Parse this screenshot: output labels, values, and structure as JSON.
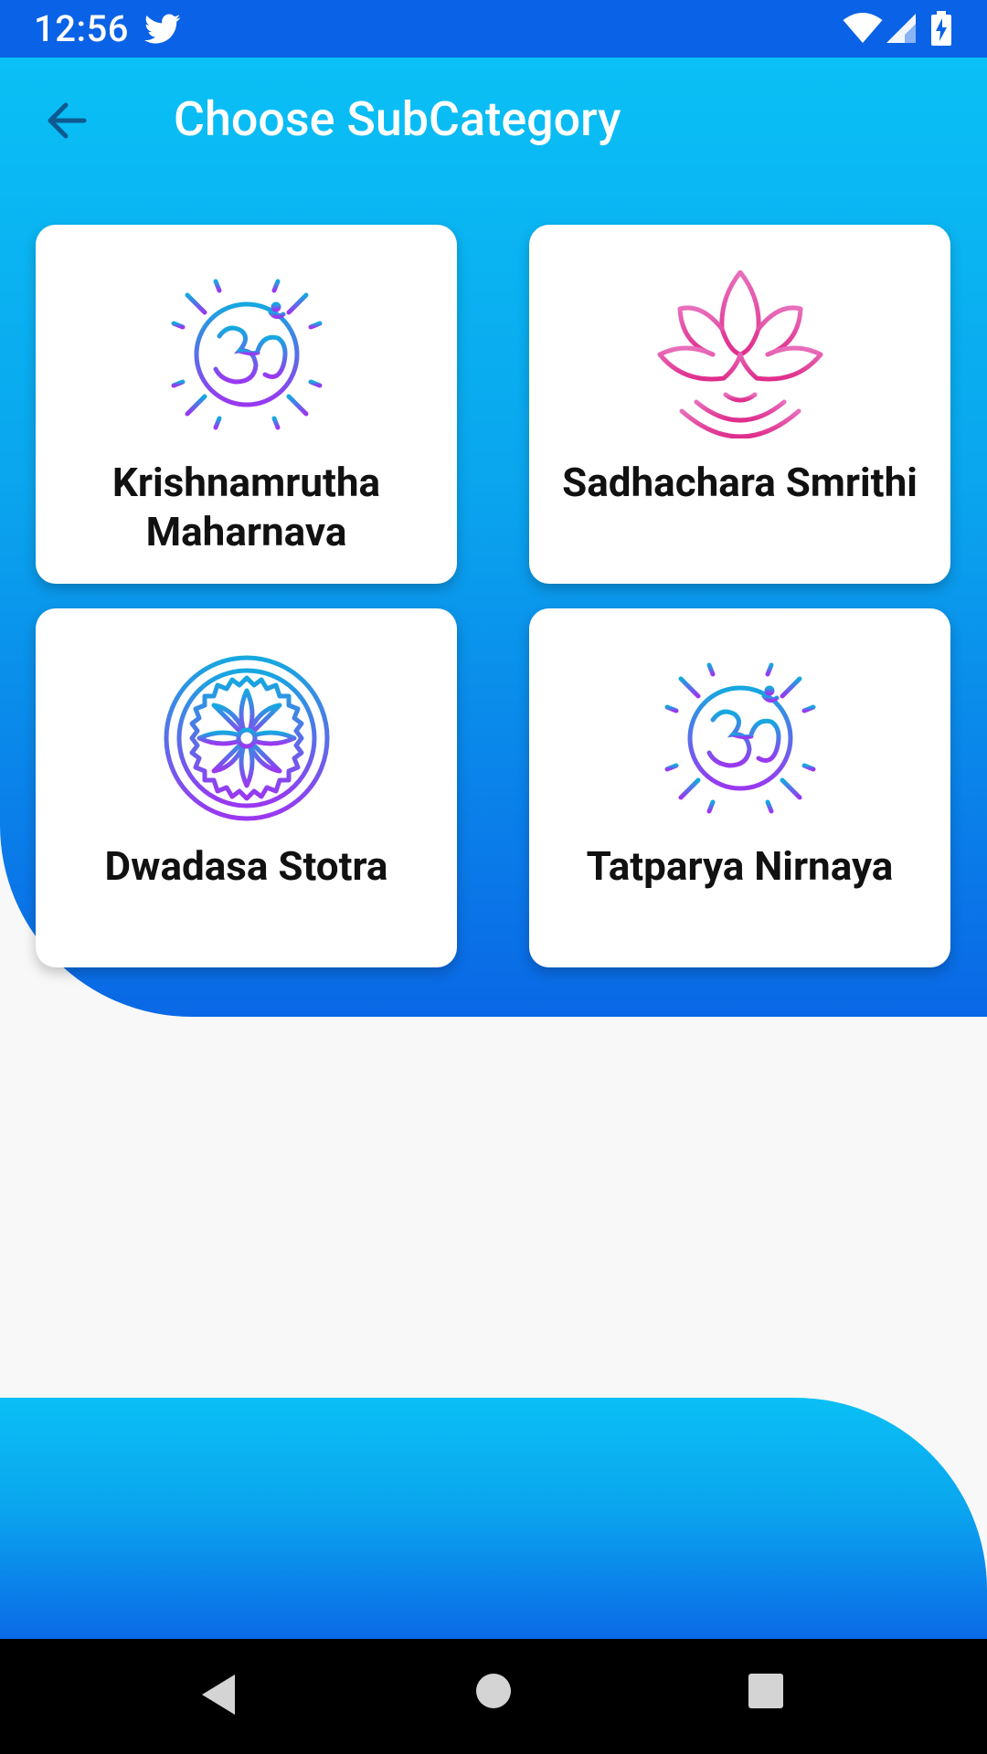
{
  "status_bar": {
    "time": "12:56",
    "icons": [
      "twitter-icon",
      "wifi-icon",
      "cell-signal-icon",
      "battery-charging-icon"
    ]
  },
  "header": {
    "title": "Choose SubCategory",
    "back_icon": "arrow-back-icon"
  },
  "cards": [
    {
      "label": "Krishnamrutha\nMaharnava",
      "icon": "om-sun-icon"
    },
    {
      "label": "Sadhachara Smrithi",
      "icon": "lotus-icon"
    },
    {
      "label": "Dwadasa Stotra",
      "icon": "mandala-chakra-icon"
    },
    {
      "label": "Tatparya Nirnaya",
      "icon": "om-sun-icon"
    }
  ],
  "nav_bar": {
    "icons": [
      "nav-back-icon",
      "nav-home-icon",
      "nav-recents-icon"
    ]
  },
  "colors": {
    "status_bar": "#0a62e6",
    "gradient_top": "#0ac0f5",
    "gradient_bottom": "#0a68e6",
    "background": "#f8f8f8",
    "card": "#ffffff",
    "om_gradient_start": "#16a8e0",
    "om_gradient_end": "#9b37f0",
    "lotus_gradient_start": "#e66fb7",
    "lotus_gradient_end": "#e0308f"
  }
}
